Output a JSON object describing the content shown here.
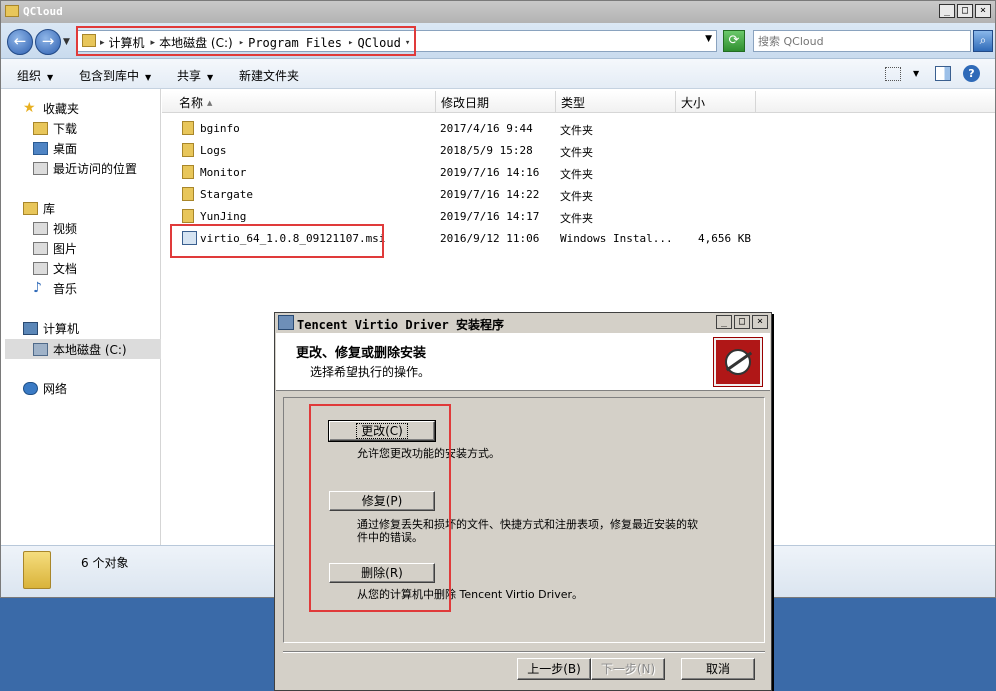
{
  "explorer": {
    "title": "QCloud",
    "breadcrumb": [
      "计算机",
      "本地磁盘 (C:)",
      "Program Files",
      "QCloud"
    ],
    "search_placeholder": "搜索 QCloud",
    "toolbar": {
      "organize": "组织",
      "include_in_library": "包含到库中",
      "share": "共享",
      "new_folder": "新建文件夹"
    },
    "sidebar": {
      "favorites": "收藏夹",
      "downloads": "下载",
      "desktop": "桌面",
      "recent_places": "最近访问的位置",
      "libraries": "库",
      "videos": "视频",
      "pictures": "图片",
      "documents": "文档",
      "music": "音乐",
      "computer": "计算机",
      "local_disk": "本地磁盘 (C:)",
      "network": "网络"
    },
    "columns": [
      "名称",
      "修改日期",
      "类型",
      "大小"
    ],
    "files": [
      {
        "name": "bginfo",
        "date": "2017/4/16 9:44",
        "type": "文件夹",
        "size": ""
      },
      {
        "name": "Logs",
        "date": "2018/5/9 15:28",
        "type": "文件夹",
        "size": ""
      },
      {
        "name": "Monitor",
        "date": "2019/7/16 14:16",
        "type": "文件夹",
        "size": ""
      },
      {
        "name": "Stargate",
        "date": "2019/7/16 14:22",
        "type": "文件夹",
        "size": ""
      },
      {
        "name": "YunJing",
        "date": "2019/7/16 14:17",
        "type": "文件夹",
        "size": ""
      },
      {
        "name": "virtio_64_1.0.8_09121107.msi",
        "date": "2016/9/12 11:06",
        "type": "Windows Instal...",
        "size": "4,656 KB"
      }
    ],
    "status": {
      "count": "6 个对象"
    }
  },
  "installer": {
    "title": "Tencent Virtio Driver 安装程序",
    "heading": "更改、修复或删除安装",
    "subheading": "选择希望执行的操作。",
    "change_label": "更改(C)",
    "change_desc": "允许您更改功能的安装方式。",
    "repair_label": "修复(P)",
    "repair_desc_line1": "通过修复丢失和损坏的文件、快捷方式和注册表项，修复最近安装的软",
    "repair_desc_line2": "件中的错误。",
    "remove_label": "删除(R)",
    "remove_desc": "从您的计算机中删除 Tencent Virtio Driver。",
    "back_label": "上一步(B)",
    "next_label": "下一步(N)",
    "cancel_label": "取消"
  },
  "colors": {
    "highlight_red": "#e03a3a",
    "desktop_blue": "#3a6aa8",
    "dialog_grey": "#d4d0c8"
  }
}
